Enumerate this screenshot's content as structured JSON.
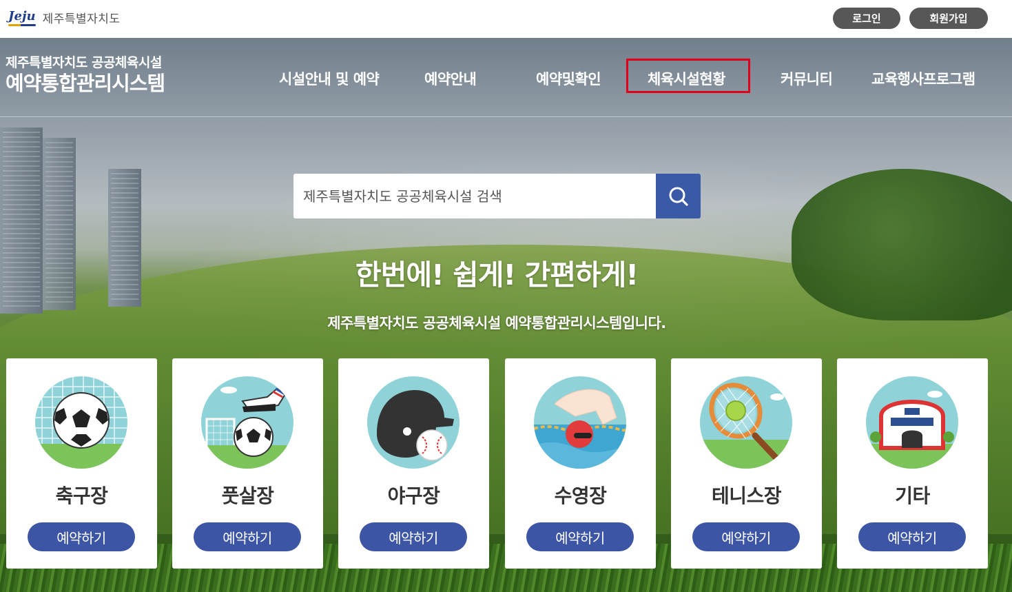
{
  "header": {
    "logo_mark": "Jeju",
    "org_name": "제주특별자치도",
    "login_label": "로그인",
    "join_label": "회원가입"
  },
  "site": {
    "subtitle": "제주특별자치도 공공체육시설",
    "title": "예약통합관리시스템"
  },
  "nav": {
    "items": [
      {
        "label": "시설안내 및 예약"
      },
      {
        "label": "예약안내"
      },
      {
        "label": "예약및확인"
      },
      {
        "label": "체육시설현황",
        "highlighted": true
      },
      {
        "label": "커뮤니티"
      },
      {
        "label": "교육행사프로그램"
      }
    ]
  },
  "search": {
    "placeholder": "제주특별자치도 공공체육시설 검색",
    "button_icon": "search-icon"
  },
  "hero": {
    "headline": "한번에! 쉽게! 간편하게!",
    "subline": "제주특별자치도 공공체육시설 예약통합관리시스템입니다."
  },
  "facilities": [
    {
      "name": "축구장",
      "icon": "soccer-ball-icon",
      "button": "예약하기"
    },
    {
      "name": "풋살장",
      "icon": "futsal-icon",
      "button": "예약하기"
    },
    {
      "name": "야구장",
      "icon": "baseball-helmet-icon",
      "button": "예약하기"
    },
    {
      "name": "수영장",
      "icon": "swimmer-icon",
      "button": "예약하기"
    },
    {
      "name": "테니스장",
      "icon": "tennis-racket-icon",
      "button": "예약하기"
    },
    {
      "name": "기타",
      "icon": "building-icon",
      "button": "예약하기"
    }
  ],
  "colors": {
    "accent": "#3c56a5",
    "search_button": "#3a5aa8",
    "highlight_box": "#e0001c",
    "top_button": "#575757"
  }
}
